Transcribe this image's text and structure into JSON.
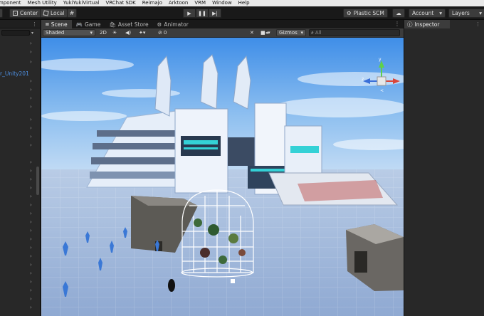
{
  "menubar": {
    "items": [
      "mponent",
      "Mesh Utility",
      "YukiYukiVirtual",
      "VRChat SDK",
      "Reimajo",
      "Arktoon",
      "VRM",
      "Window",
      "Help"
    ]
  },
  "toolbar": {
    "center_label": "Center",
    "local_label": "Local",
    "plastic_label": "Plastic SCM",
    "account_label": "Account",
    "layers_label": "Layers"
  },
  "hierarchy": {
    "item_label": "r_Unity201"
  },
  "scene": {
    "tabs": [
      {
        "label": "Scene",
        "icon": "scene-icon"
      },
      {
        "label": "Game",
        "icon": "game-icon"
      },
      {
        "label": "Asset Store",
        "icon": "store-icon"
      },
      {
        "label": "Animator",
        "icon": "animator-icon"
      }
    ],
    "shading_mode": "Shaded",
    "mode_2d": "2D",
    "audio_count": "0",
    "gizmos_label": "Gizmos",
    "search_placeholder": "All"
  },
  "inspector": {
    "tab_label": "Inspector"
  },
  "colors": {
    "accent": "#4d8ee0",
    "sky": "#7fb4ea",
    "ground": "#a8c0de",
    "panel": "#282828"
  }
}
